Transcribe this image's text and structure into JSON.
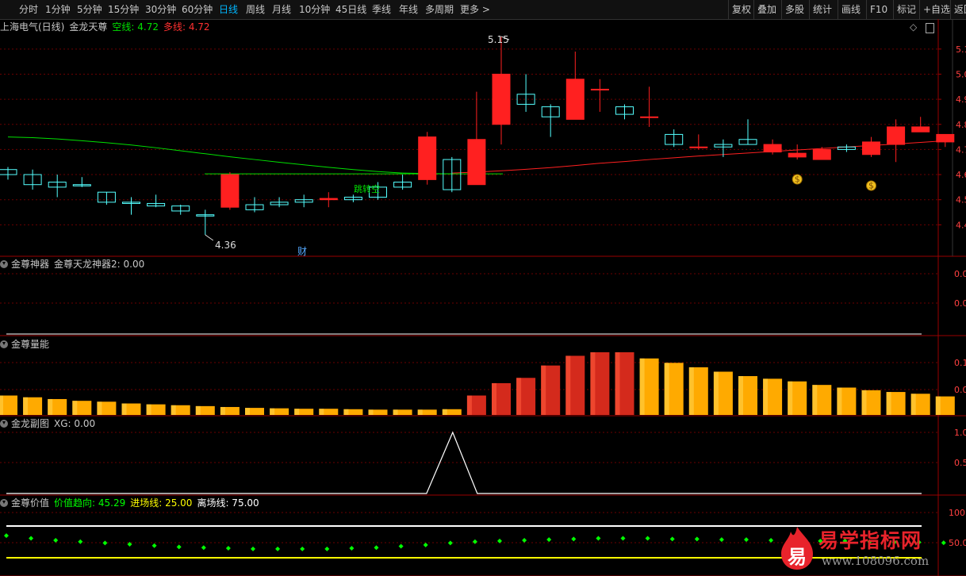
{
  "toolbar": {
    "periods": [
      "分时",
      "1分钟",
      "5分钟",
      "15分钟",
      "30分钟",
      "60分钟",
      "日线",
      "周线",
      "月线",
      "10分钟",
      "45日线",
      "季线",
      "年线",
      "多周期",
      "更多 >"
    ],
    "active_period": "日线",
    "right_buttons": [
      "复权",
      "叠加",
      "多股",
      "统计",
      "画线",
      "F10",
      "标记",
      "+自选",
      "返回"
    ]
  },
  "main_panel": {
    "stock": "上海电气(日线)",
    "indicator": "金龙天尊",
    "kong_label": "空线: 4.72",
    "duo_label": "多线: 4.72",
    "high_label": "5.15",
    "low_label": "4.36",
    "note_cai": "财",
    "note_cross": "跳转空",
    "axis_labels": [
      "5.1",
      "5.0",
      "4.9",
      "4.8",
      "4.7",
      "4.6",
      "4.5",
      "4.4"
    ]
  },
  "panel2": {
    "name": "金尊神器",
    "label": "金尊天龙神器2: 0.00",
    "axis_labels": [
      "0.0",
      "0.0"
    ]
  },
  "panel3": {
    "name": "金尊量能",
    "axis_labels": [
      "0.1",
      "0.0"
    ]
  },
  "panel4": {
    "name": "金龙副图",
    "label": "XG: 0.00",
    "axis_labels": [
      "1.0",
      "0.5"
    ]
  },
  "panel5": {
    "name": "金尊价值",
    "jiazhi_label": "价值趋向: 45.29",
    "jinchang_label": "进场线: 25.00",
    "lichang_label": "离场线: 75.00",
    "axis_labels": [
      "100",
      "50.0"
    ]
  },
  "watermark": {
    "logo_char": "易",
    "name": "易学指标网",
    "url": "www.108096.com"
  },
  "colors": {
    "up": "#ff2020",
    "down": "#54ffff",
    "kong": "#00e000",
    "duo": "#ff2020",
    "grid": "#6b0000",
    "axis": "#9a0000",
    "vol_up": "#d42a1c",
    "vol_gold": "#ffaa00",
    "value_dots": "#00ff00",
    "line_white": "#ffffff",
    "line_yellow": "#ffff00"
  },
  "chart_data": {
    "type": "candlestick",
    "ylim": [
      4.36,
      5.18
    ],
    "candles": [
      {
        "o": 4.62,
        "h": 4.63,
        "l": 4.58,
        "c": 4.6
      },
      {
        "o": 4.6,
        "h": 4.62,
        "l": 4.54,
        "c": 4.56
      },
      {
        "o": 4.57,
        "h": 4.6,
        "l": 4.51,
        "c": 4.55
      },
      {
        "o": 4.56,
        "h": 4.59,
        "l": 4.55,
        "c": 4.555
      },
      {
        "o": 4.53,
        "h": 4.53,
        "l": 4.48,
        "c": 4.49
      },
      {
        "o": 4.49,
        "h": 4.51,
        "l": 4.44,
        "c": 4.485
      },
      {
        "o": 4.485,
        "h": 4.52,
        "l": 4.47,
        "c": 4.475
      },
      {
        "o": 4.475,
        "h": 4.48,
        "l": 4.44,
        "c": 4.455
      },
      {
        "o": 4.44,
        "h": 4.46,
        "l": 4.36,
        "c": 4.435
      },
      {
        "o": 4.47,
        "h": 4.61,
        "l": 4.46,
        "c": 4.6
      },
      {
        "o": 4.48,
        "h": 4.51,
        "l": 4.45,
        "c": 4.46
      },
      {
        "o": 4.49,
        "h": 4.51,
        "l": 4.47,
        "c": 4.48
      },
      {
        "o": 4.5,
        "h": 4.52,
        "l": 4.47,
        "c": 4.49
      },
      {
        "o": 4.5,
        "h": 4.53,
        "l": 4.47,
        "c": 4.505
      },
      {
        "o": 4.51,
        "h": 4.52,
        "l": 4.49,
        "c": 4.5
      },
      {
        "o": 4.55,
        "h": 4.57,
        "l": 4.5,
        "c": 4.51
      },
      {
        "o": 4.57,
        "h": 4.6,
        "l": 4.54,
        "c": 4.55
      },
      {
        "o": 4.58,
        "h": 4.77,
        "l": 4.56,
        "c": 4.75
      },
      {
        "o": 4.66,
        "h": 4.67,
        "l": 4.53,
        "c": 4.54
      },
      {
        "o": 4.56,
        "h": 4.93,
        "l": 4.56,
        "c": 4.74
      },
      {
        "o": 4.8,
        "h": 5.15,
        "l": 4.72,
        "c": 5.0
      },
      {
        "o": 4.92,
        "h": 5.0,
        "l": 4.85,
        "c": 4.88
      },
      {
        "o": 4.87,
        "h": 4.88,
        "l": 4.75,
        "c": 4.83
      },
      {
        "o": 4.82,
        "h": 5.09,
        "l": 4.82,
        "c": 4.98
      },
      {
        "o": 4.94,
        "h": 4.98,
        "l": 4.85,
        "c": 4.94
      },
      {
        "o": 4.87,
        "h": 4.88,
        "l": 4.82,
        "c": 4.84
      },
      {
        "o": 4.83,
        "h": 4.95,
        "l": 4.79,
        "c": 4.83
      },
      {
        "o": 4.76,
        "h": 4.78,
        "l": 4.71,
        "c": 4.72
      },
      {
        "o": 4.71,
        "h": 4.76,
        "l": 4.7,
        "c": 4.71
      },
      {
        "o": 4.72,
        "h": 4.74,
        "l": 4.67,
        "c": 4.71
      },
      {
        "o": 4.74,
        "h": 4.82,
        "l": 4.72,
        "c": 4.72
      },
      {
        "o": 4.69,
        "h": 4.74,
        "l": 4.68,
        "c": 4.72
      },
      {
        "o": 4.67,
        "h": 4.72,
        "l": 4.66,
        "c": 4.685
      },
      {
        "o": 4.66,
        "h": 4.71,
        "l": 4.66,
        "c": 4.7
      },
      {
        "o": 4.71,
        "h": 4.72,
        "l": 4.69,
        "c": 4.7
      },
      {
        "o": 4.68,
        "h": 4.75,
        "l": 4.67,
        "c": 4.73
      },
      {
        "o": 4.72,
        "h": 4.82,
        "l": 4.65,
        "c": 4.79
      },
      {
        "o": 4.77,
        "h": 4.83,
        "l": 4.77,
        "c": 4.79
      },
      {
        "o": 4.73,
        "h": 4.76,
        "l": 4.71,
        "c": 4.76
      }
    ],
    "ma_green": [
      4.75,
      4.747,
      4.742,
      4.735,
      4.727,
      4.718,
      4.707,
      4.695,
      4.683,
      4.671,
      4.66,
      4.649,
      4.639,
      4.629,
      4.62,
      4.612,
      4.606,
      4.604,
      4.603
    ],
    "ma_red": [
      4.606,
      4.61,
      4.615,
      4.621,
      4.628,
      4.636,
      4.645,
      4.652,
      4.66,
      4.667,
      4.674,
      4.68,
      4.686,
      4.692,
      4.698,
      4.704,
      4.71,
      4.716,
      4.722,
      4.728,
      4.735
    ],
    "vol": [
      0.22,
      0.2,
      0.18,
      0.16,
      0.15,
      0.13,
      0.12,
      0.11,
      0.1,
      0.09,
      0.08,
      0.075,
      0.07,
      0.07,
      0.065,
      0.06,
      0.06,
      0.06,
      0.065,
      0.22,
      0.36,
      0.42,
      0.56,
      0.67,
      0.71,
      0.71,
      0.64,
      0.59,
      0.54,
      0.49,
      0.44,
      0.41,
      0.38,
      0.34,
      0.31,
      0.28,
      0.26,
      0.24,
      0.21
    ],
    "vol_red_from": 19,
    "vol_red_to": 25,
    "xg_peak_index": 18,
    "xg_peak_value": 1.0,
    "value_trend": [
      56,
      52,
      49,
      47,
      45,
      43,
      41,
      39,
      38,
      37,
      36,
      36,
      36,
      36,
      37,
      38,
      40,
      42,
      45,
      47,
      48,
      49,
      50,
      51,
      52,
      52,
      52,
      51,
      51,
      50,
      50,
      49,
      49,
      48,
      48,
      47,
      46,
      46,
      45.29
    ],
    "value_ylim": [
      0,
      110
    ],
    "entry_line": 25.0,
    "exit_line": 75.0
  }
}
